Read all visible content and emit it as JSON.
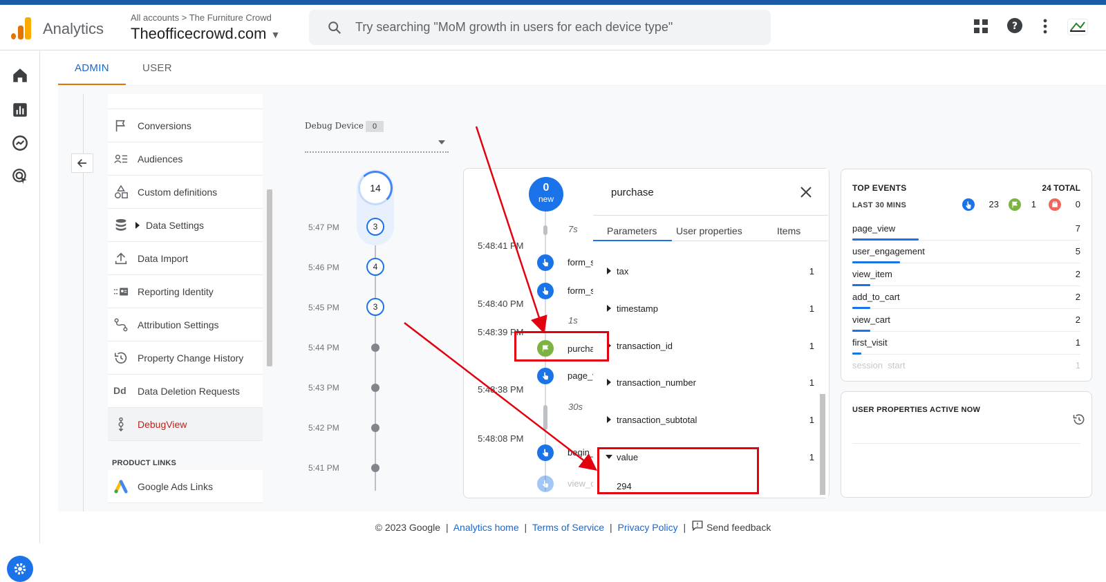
{
  "header": {
    "app_name": "Analytics",
    "breadcrumb_all": "All accounts",
    "breadcrumb_account": "The Furniture Crowd",
    "property_name": "Theofficecrowd.com",
    "search_placeholder": "Try searching \"MoM growth in users for each device type\""
  },
  "tabs": {
    "admin": "ADMIN",
    "user": "USER"
  },
  "menu": {
    "items": [
      {
        "label": "Conversions",
        "icon": "flag-icon"
      },
      {
        "label": "Audiences",
        "icon": "audiences-icon"
      },
      {
        "label": "Custom definitions",
        "icon": "shapes-icon"
      },
      {
        "label": "Data Settings",
        "icon": "database-icon"
      },
      {
        "label": "Data Import",
        "icon": "upload-icon"
      },
      {
        "label": "Reporting Identity",
        "icon": "identity-icon"
      },
      {
        "label": "Attribution Settings",
        "icon": "attribution-icon"
      },
      {
        "label": "Property Change History",
        "icon": "history-icon"
      },
      {
        "label": "Data Deletion Requests",
        "icon": "dd-icon"
      },
      {
        "label": "DebugView",
        "icon": "debug-icon"
      }
    ],
    "product_links_label": "PRODUCT LINKS",
    "google_ads_links": "Google Ads Links"
  },
  "debug": {
    "device_label": "Debug Device",
    "device_count": "0",
    "seconds_count": "14",
    "minutes": [
      {
        "time": "5:47 PM",
        "count": "3"
      },
      {
        "time": "5:46 PM",
        "count": "4"
      },
      {
        "time": "5:45 PM",
        "count": "3"
      },
      {
        "time": "5:44 PM",
        "count": ""
      },
      {
        "time": "5:43 PM",
        "count": ""
      },
      {
        "time": "5:42 PM",
        "count": ""
      },
      {
        "time": "5:41 PM",
        "count": ""
      }
    ]
  },
  "stream": {
    "new_count": "0",
    "new_label": "new",
    "gaps": [
      "7s",
      "1s",
      "30s"
    ],
    "times": [
      "5:48:41 PM",
      "5:48:40 PM",
      "5:48:39 PM",
      "5:48:38 PM",
      "5:48:08 PM"
    ],
    "events": [
      "form_s",
      "form_s",
      "purcha",
      "page_v",
      "begin_",
      "view_c"
    ]
  },
  "event_detail": {
    "title": "purchase",
    "tabs": [
      "Parameters",
      "User properties",
      "Items"
    ],
    "params": [
      {
        "key": "tax",
        "count": "1"
      },
      {
        "key": "timestamp",
        "count": "1"
      },
      {
        "key": "transaction_id",
        "count": "1"
      },
      {
        "key": "transaction_number",
        "count": "1"
      },
      {
        "key": "transaction_subtotal",
        "count": "1"
      },
      {
        "key": "value",
        "count": "1"
      }
    ],
    "value_expanded": "294"
  },
  "top_events": {
    "title": "TOP EVENTS",
    "total": "24 TOTAL",
    "period": "LAST 30 MINS",
    "badge_events": "23",
    "badge_conversions": "1",
    "badge_errors": "0",
    "rows": [
      {
        "name": "page_view",
        "count": "7",
        "fraction": 0.29
      },
      {
        "name": "user_engagement",
        "count": "5",
        "fraction": 0.21
      },
      {
        "name": "view_item",
        "count": "2",
        "fraction": 0.08
      },
      {
        "name": "add_to_cart",
        "count": "2",
        "fraction": 0.08
      },
      {
        "name": "view_cart",
        "count": "2",
        "fraction": 0.08
      },
      {
        "name": "first_visit",
        "count": "1",
        "fraction": 0.04
      },
      {
        "name": "session_start",
        "count": "1",
        "fraction": 0.04
      }
    ]
  },
  "user_properties": {
    "title": "USER PROPERTIES ACTIVE NOW"
  },
  "footer": {
    "copyright": "© 2023 Google",
    "analytics_home": "Analytics home",
    "terms": "Terms of Service",
    "privacy": "Privacy Policy",
    "feedback": "Send feedback"
  },
  "colors": {
    "accent_blue": "#1a73e8",
    "tab_orange": "#e37400",
    "annotation_red": "#e2020f",
    "conversion_green": "#7cb342"
  }
}
